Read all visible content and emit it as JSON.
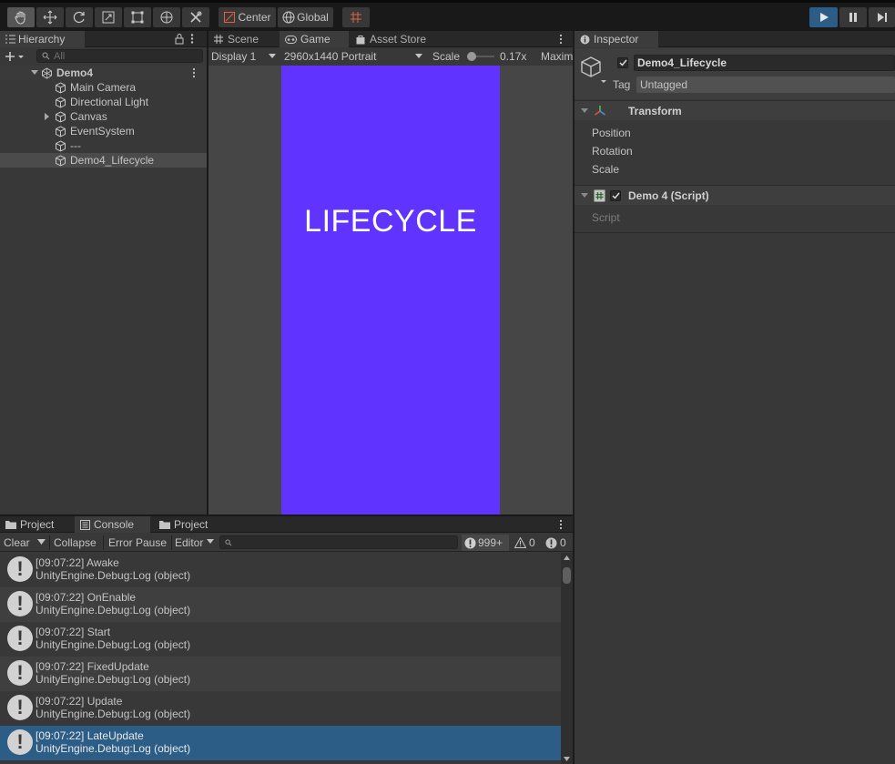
{
  "toolbar": {
    "pivot_label": "Center",
    "space_label": "Global"
  },
  "hierarchy": {
    "tab": "Hierarchy",
    "search_placeholder": "All",
    "scene": "Demo4",
    "items": [
      {
        "label": "Main Camera"
      },
      {
        "label": "Directional Light"
      },
      {
        "label": "Canvas"
      },
      {
        "label": "EventSystem"
      },
      {
        "label": "---"
      },
      {
        "label": "Demo4_Lifecycle"
      }
    ]
  },
  "game": {
    "tabs": [
      "Scene",
      "Game",
      "Asset Store"
    ],
    "display": "Display 1",
    "resolution": "2960x1440 Portrait",
    "scale_label": "Scale",
    "scale_value": "0.17x",
    "maximize": "Maxim",
    "canvas_text": "LIFECYCLE",
    "canvas_color": "#6133ff"
  },
  "inspector": {
    "tab": "Inspector",
    "object_name": "Demo4_Lifecycle",
    "tag_label": "Tag",
    "tag_value": "Untagged",
    "transform": {
      "title": "Transform",
      "props": [
        "Position",
        "Rotation",
        "Scale"
      ]
    },
    "script": {
      "title": "Demo 4 (Script)",
      "prop": "Script"
    }
  },
  "console": {
    "tabs": [
      "Project",
      "Console",
      "Project"
    ],
    "toolbar": {
      "clear": "Clear",
      "collapse": "Collapse",
      "error_pause": "Error Pause",
      "editor": "Editor",
      "log_count": "999+",
      "warn_count": "0",
      "error_count": "0"
    },
    "logs": [
      {
        "line1": "[09:07:22] Awake",
        "line2": "UnityEngine.Debug:Log (object)"
      },
      {
        "line1": "[09:07:22] OnEnable",
        "line2": "UnityEngine.Debug:Log (object)"
      },
      {
        "line1": "[09:07:22] Start",
        "line2": "UnityEngine.Debug:Log (object)"
      },
      {
        "line1": "[09:07:22] FixedUpdate",
        "line2": "UnityEngine.Debug:Log (object)"
      },
      {
        "line1": "[09:07:22] Update",
        "line2": "UnityEngine.Debug:Log (object)"
      },
      {
        "line1": "[09:07:22] LateUpdate",
        "line2": "UnityEngine.Debug:Log (object)"
      }
    ]
  },
  "colors": {
    "accent": "#2c5d87",
    "panel": "#383838"
  }
}
